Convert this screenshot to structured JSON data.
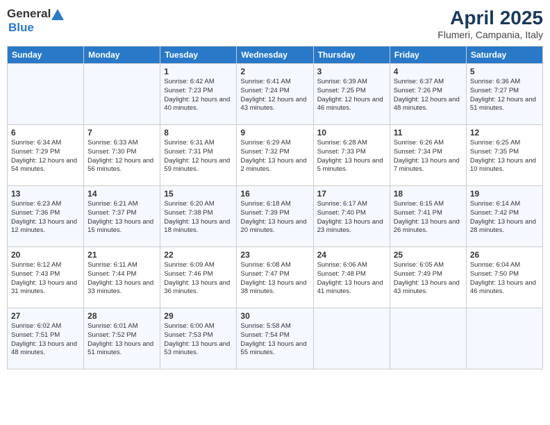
{
  "header": {
    "logo_general": "General",
    "logo_blue": "Blue",
    "title": "April 2025",
    "location": "Flumeri, Campania, Italy"
  },
  "days_of_week": [
    "Sunday",
    "Monday",
    "Tuesday",
    "Wednesday",
    "Thursday",
    "Friday",
    "Saturday"
  ],
  "weeks": [
    [
      {
        "day": "",
        "sunrise": "",
        "sunset": "",
        "daylight": ""
      },
      {
        "day": "",
        "sunrise": "",
        "sunset": "",
        "daylight": ""
      },
      {
        "day": "1",
        "sunrise": "Sunrise: 6:42 AM",
        "sunset": "Sunset: 7:23 PM",
        "daylight": "Daylight: 12 hours and 40 minutes."
      },
      {
        "day": "2",
        "sunrise": "Sunrise: 6:41 AM",
        "sunset": "Sunset: 7:24 PM",
        "daylight": "Daylight: 12 hours and 43 minutes."
      },
      {
        "day": "3",
        "sunrise": "Sunrise: 6:39 AM",
        "sunset": "Sunset: 7:25 PM",
        "daylight": "Daylight: 12 hours and 46 minutes."
      },
      {
        "day": "4",
        "sunrise": "Sunrise: 6:37 AM",
        "sunset": "Sunset: 7:26 PM",
        "daylight": "Daylight: 12 hours and 48 minutes."
      },
      {
        "day": "5",
        "sunrise": "Sunrise: 6:36 AM",
        "sunset": "Sunset: 7:27 PM",
        "daylight": "Daylight: 12 hours and 51 minutes."
      }
    ],
    [
      {
        "day": "6",
        "sunrise": "Sunrise: 6:34 AM",
        "sunset": "Sunset: 7:29 PM",
        "daylight": "Daylight: 12 hours and 54 minutes."
      },
      {
        "day": "7",
        "sunrise": "Sunrise: 6:33 AM",
        "sunset": "Sunset: 7:30 PM",
        "daylight": "Daylight: 12 hours and 56 minutes."
      },
      {
        "day": "8",
        "sunrise": "Sunrise: 6:31 AM",
        "sunset": "Sunset: 7:31 PM",
        "daylight": "Daylight: 12 hours and 59 minutes."
      },
      {
        "day": "9",
        "sunrise": "Sunrise: 6:29 AM",
        "sunset": "Sunset: 7:32 PM",
        "daylight": "Daylight: 13 hours and 2 minutes."
      },
      {
        "day": "10",
        "sunrise": "Sunrise: 6:28 AM",
        "sunset": "Sunset: 7:33 PM",
        "daylight": "Daylight: 13 hours and 5 minutes."
      },
      {
        "day": "11",
        "sunrise": "Sunrise: 6:26 AM",
        "sunset": "Sunset: 7:34 PM",
        "daylight": "Daylight: 13 hours and 7 minutes."
      },
      {
        "day": "12",
        "sunrise": "Sunrise: 6:25 AM",
        "sunset": "Sunset: 7:35 PM",
        "daylight": "Daylight: 13 hours and 10 minutes."
      }
    ],
    [
      {
        "day": "13",
        "sunrise": "Sunrise: 6:23 AM",
        "sunset": "Sunset: 7:36 PM",
        "daylight": "Daylight: 13 hours and 12 minutes."
      },
      {
        "day": "14",
        "sunrise": "Sunrise: 6:21 AM",
        "sunset": "Sunset: 7:37 PM",
        "daylight": "Daylight: 13 hours and 15 minutes."
      },
      {
        "day": "15",
        "sunrise": "Sunrise: 6:20 AM",
        "sunset": "Sunset: 7:38 PM",
        "daylight": "Daylight: 13 hours and 18 minutes."
      },
      {
        "day": "16",
        "sunrise": "Sunrise: 6:18 AM",
        "sunset": "Sunset: 7:39 PM",
        "daylight": "Daylight: 13 hours and 20 minutes."
      },
      {
        "day": "17",
        "sunrise": "Sunrise: 6:17 AM",
        "sunset": "Sunset: 7:40 PM",
        "daylight": "Daylight: 13 hours and 23 minutes."
      },
      {
        "day": "18",
        "sunrise": "Sunrise: 6:15 AM",
        "sunset": "Sunset: 7:41 PM",
        "daylight": "Daylight: 13 hours and 26 minutes."
      },
      {
        "day": "19",
        "sunrise": "Sunrise: 6:14 AM",
        "sunset": "Sunset: 7:42 PM",
        "daylight": "Daylight: 13 hours and 28 minutes."
      }
    ],
    [
      {
        "day": "20",
        "sunrise": "Sunrise: 6:12 AM",
        "sunset": "Sunset: 7:43 PM",
        "daylight": "Daylight: 13 hours and 31 minutes."
      },
      {
        "day": "21",
        "sunrise": "Sunrise: 6:11 AM",
        "sunset": "Sunset: 7:44 PM",
        "daylight": "Daylight: 13 hours and 33 minutes."
      },
      {
        "day": "22",
        "sunrise": "Sunrise: 6:09 AM",
        "sunset": "Sunset: 7:46 PM",
        "daylight": "Daylight: 13 hours and 36 minutes."
      },
      {
        "day": "23",
        "sunrise": "Sunrise: 6:08 AM",
        "sunset": "Sunset: 7:47 PM",
        "daylight": "Daylight: 13 hours and 38 minutes."
      },
      {
        "day": "24",
        "sunrise": "Sunrise: 6:06 AM",
        "sunset": "Sunset: 7:48 PM",
        "daylight": "Daylight: 13 hours and 41 minutes."
      },
      {
        "day": "25",
        "sunrise": "Sunrise: 6:05 AM",
        "sunset": "Sunset: 7:49 PM",
        "daylight": "Daylight: 13 hours and 43 minutes."
      },
      {
        "day": "26",
        "sunrise": "Sunrise: 6:04 AM",
        "sunset": "Sunset: 7:50 PM",
        "daylight": "Daylight: 13 hours and 46 minutes."
      }
    ],
    [
      {
        "day": "27",
        "sunrise": "Sunrise: 6:02 AM",
        "sunset": "Sunset: 7:51 PM",
        "daylight": "Daylight: 13 hours and 48 minutes."
      },
      {
        "day": "28",
        "sunrise": "Sunrise: 6:01 AM",
        "sunset": "Sunset: 7:52 PM",
        "daylight": "Daylight: 13 hours and 51 minutes."
      },
      {
        "day": "29",
        "sunrise": "Sunrise: 6:00 AM",
        "sunset": "Sunset: 7:53 PM",
        "daylight": "Daylight: 13 hours and 53 minutes."
      },
      {
        "day": "30",
        "sunrise": "Sunrise: 5:58 AM",
        "sunset": "Sunset: 7:54 PM",
        "daylight": "Daylight: 13 hours and 55 minutes."
      },
      {
        "day": "",
        "sunrise": "",
        "sunset": "",
        "daylight": ""
      },
      {
        "day": "",
        "sunrise": "",
        "sunset": "",
        "daylight": ""
      },
      {
        "day": "",
        "sunrise": "",
        "sunset": "",
        "daylight": ""
      }
    ]
  ]
}
